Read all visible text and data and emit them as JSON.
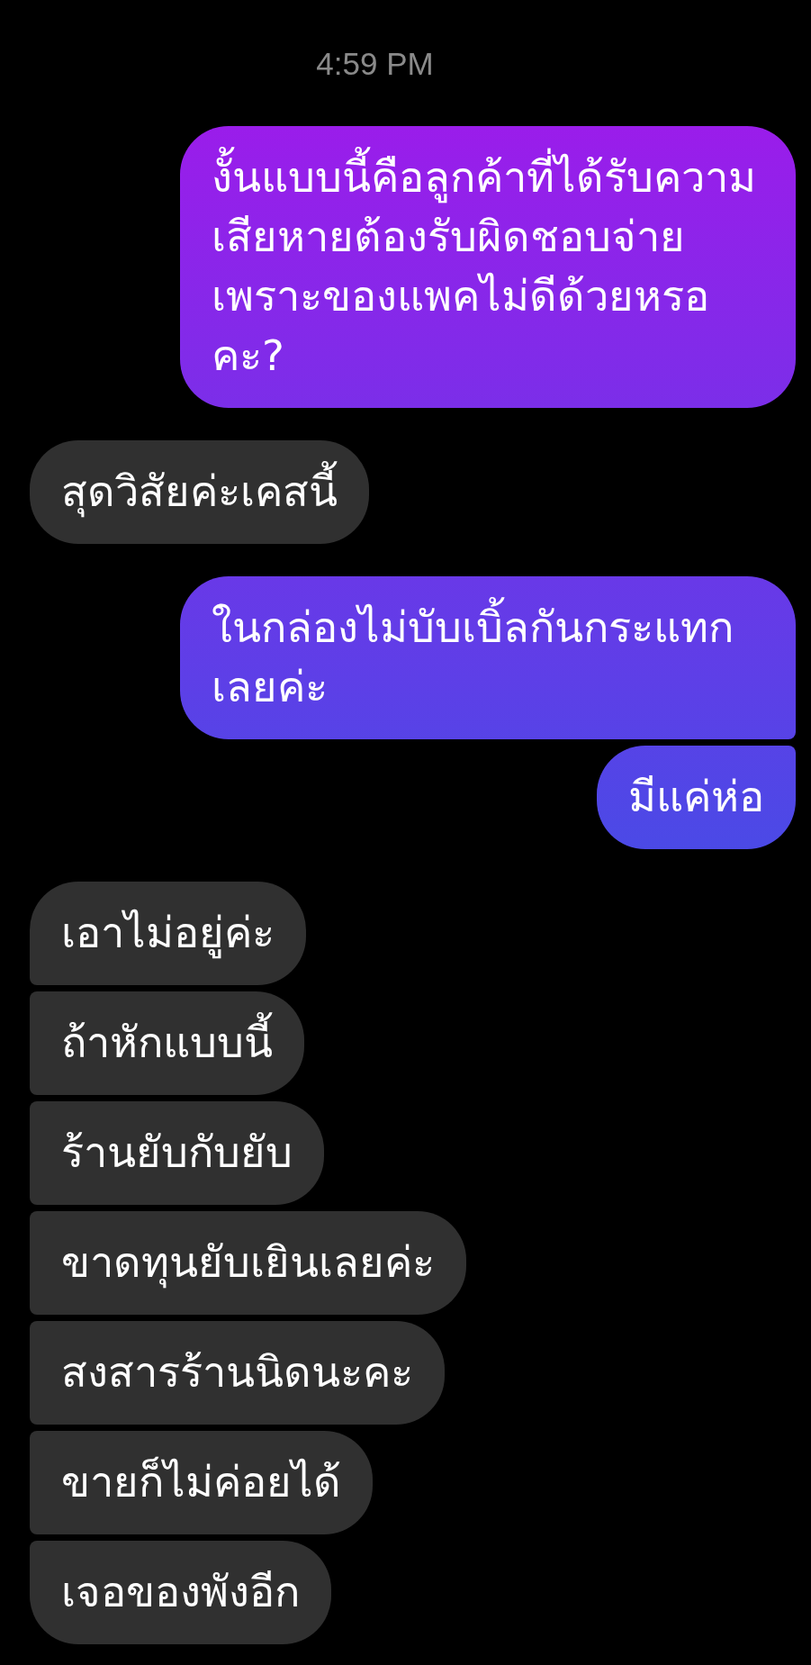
{
  "timestamp": "4:59 PM",
  "groups": [
    {
      "kind": "sent",
      "messages": [
        "งั้นแบบนี้คือลูกค้าที่ได้รับความเสียหายต้องรับผิดชอบจ่ายเพราะของแพคไม่ดีด้วยหรอคะ?"
      ]
    },
    {
      "kind": "received",
      "messages": [
        "สุดวิสัยค่ะเคสนี้"
      ]
    },
    {
      "kind": "sent",
      "messages": [
        "ในกล่องไม่บับเบิ้ลกันกระแทกเลยค่ะ",
        "มีแค่ห่อ"
      ]
    },
    {
      "kind": "received",
      "messages": [
        "เอาไม่อยู่ค่ะ",
        "ถ้าหักแบบนี้",
        "ร้านยับกับยับ",
        "ขาดทุนยับเยินเลยค่ะ",
        "สงสารร้านนิดนะคะ",
        "ขายก็ไม่ค่อยได้",
        "เจอของพังอีก"
      ]
    }
  ]
}
